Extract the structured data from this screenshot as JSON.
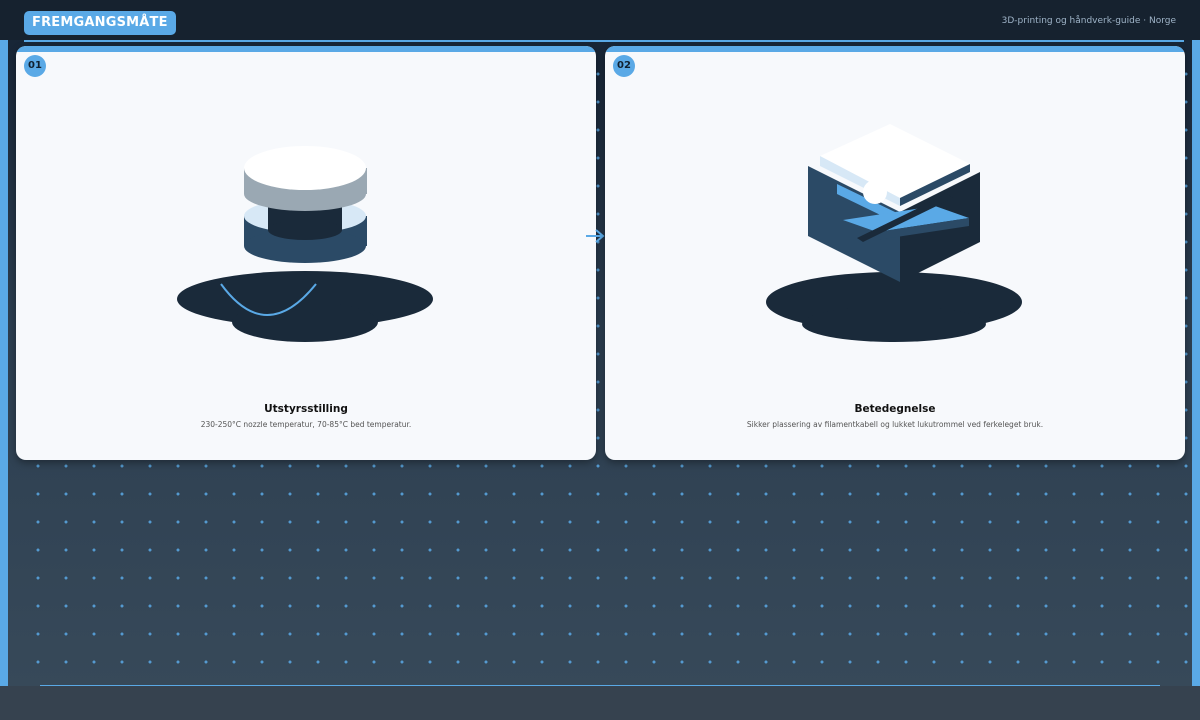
{
  "header": {
    "badge": "FREMGANGSMÅTE",
    "brand": "3D-printing og håndverk-guide · Norge"
  },
  "steps": [
    {
      "number": "01",
      "title": "Utstyrsstilling",
      "description": "230-250°C nozzle temperatur, 70-85°C bed temperatur.",
      "illustration_icon": "nozzle-stack-icon"
    },
    {
      "number": "02",
      "title": "Betedegnelse",
      "description": "Sikker plassering av filamentkabell og lukket lukutrommel ved ferkeleget bruk.",
      "illustration_icon": "printer-cube-icon"
    }
  ],
  "colors": {
    "accent": "#5aa9e6",
    "dark_navy": "#1a2a3a",
    "card_bg": "#f7f9fc"
  }
}
